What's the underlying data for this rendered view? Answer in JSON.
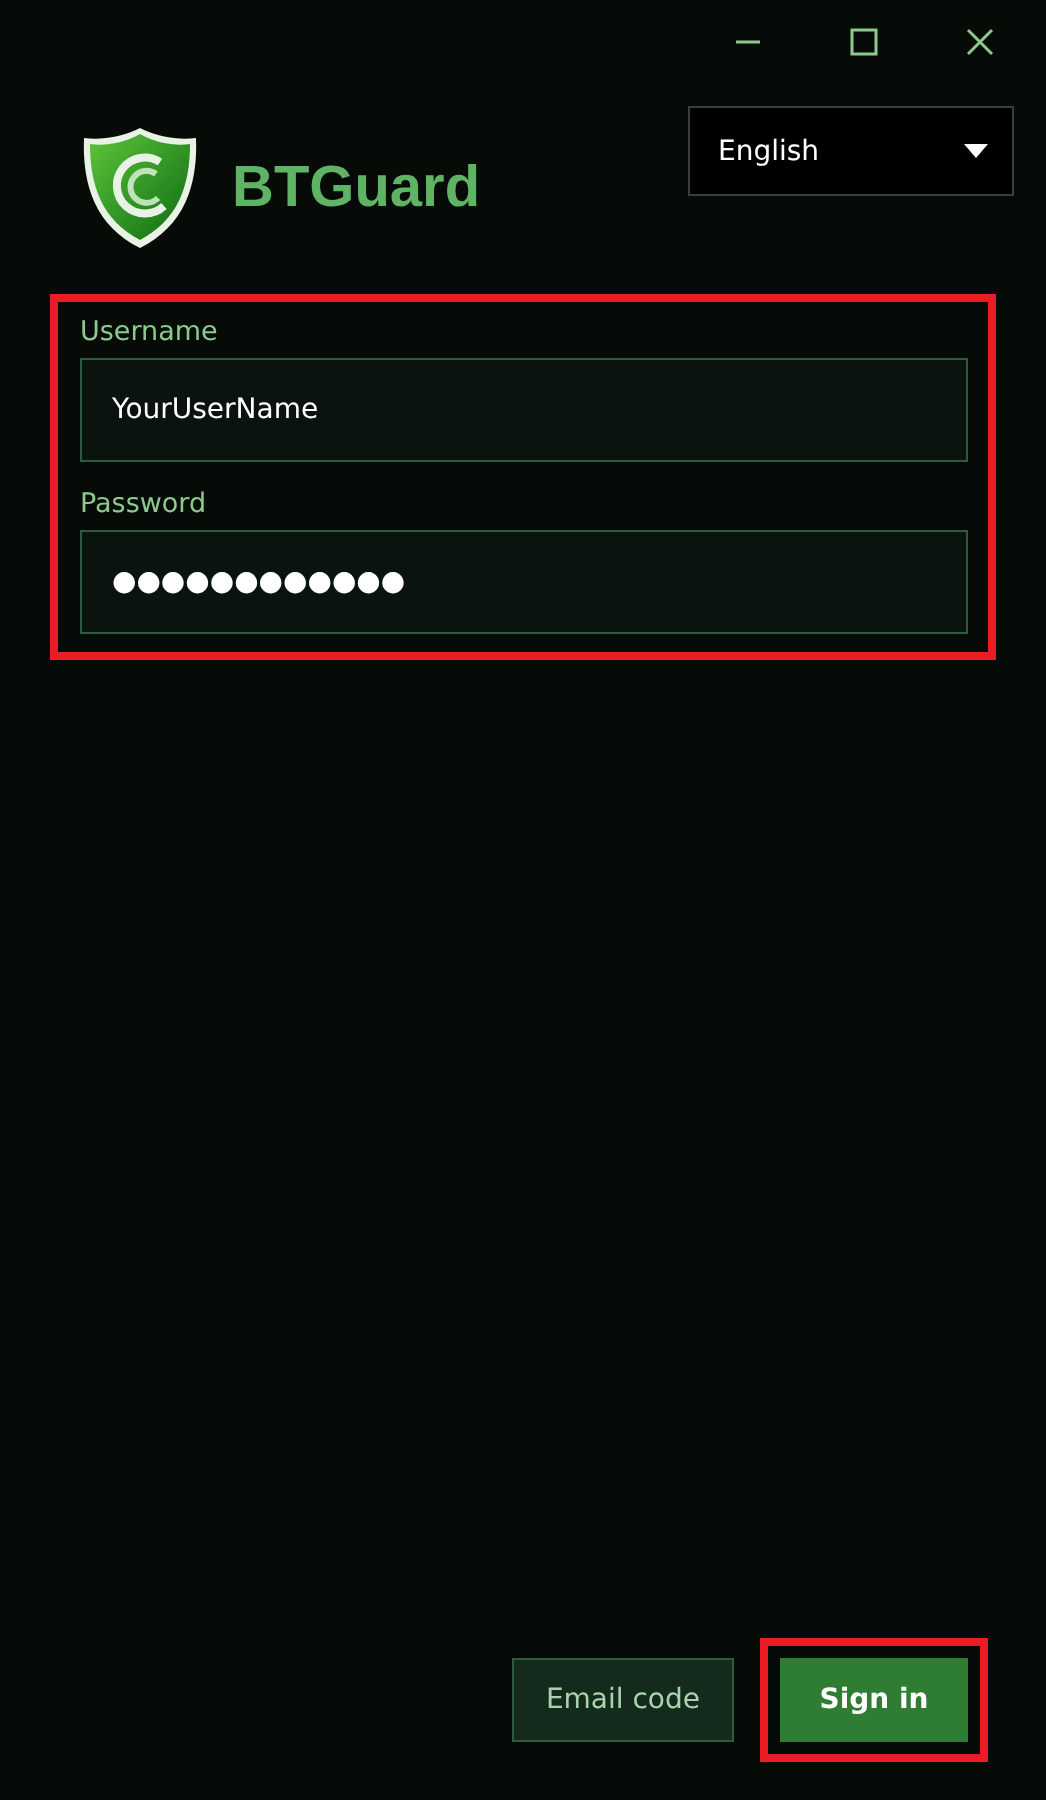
{
  "window": {
    "controls": [
      {
        "kind": "minimize"
      },
      {
        "kind": "maximize"
      },
      {
        "kind": "close"
      }
    ]
  },
  "brand": {
    "name": "BTGuard"
  },
  "language": {
    "value": "English"
  },
  "form": {
    "highlighted": true,
    "fields": [
      {
        "label": "Username",
        "value": "YourUserName"
      },
      {
        "label": "Password",
        "value": "●●●●●●●●●●●●"
      }
    ]
  },
  "buttons": [
    {
      "label": "Email code",
      "kind": "secondary",
      "highlighted": false
    },
    {
      "label": "Sign in",
      "kind": "primary",
      "highlighted": true
    }
  ]
}
